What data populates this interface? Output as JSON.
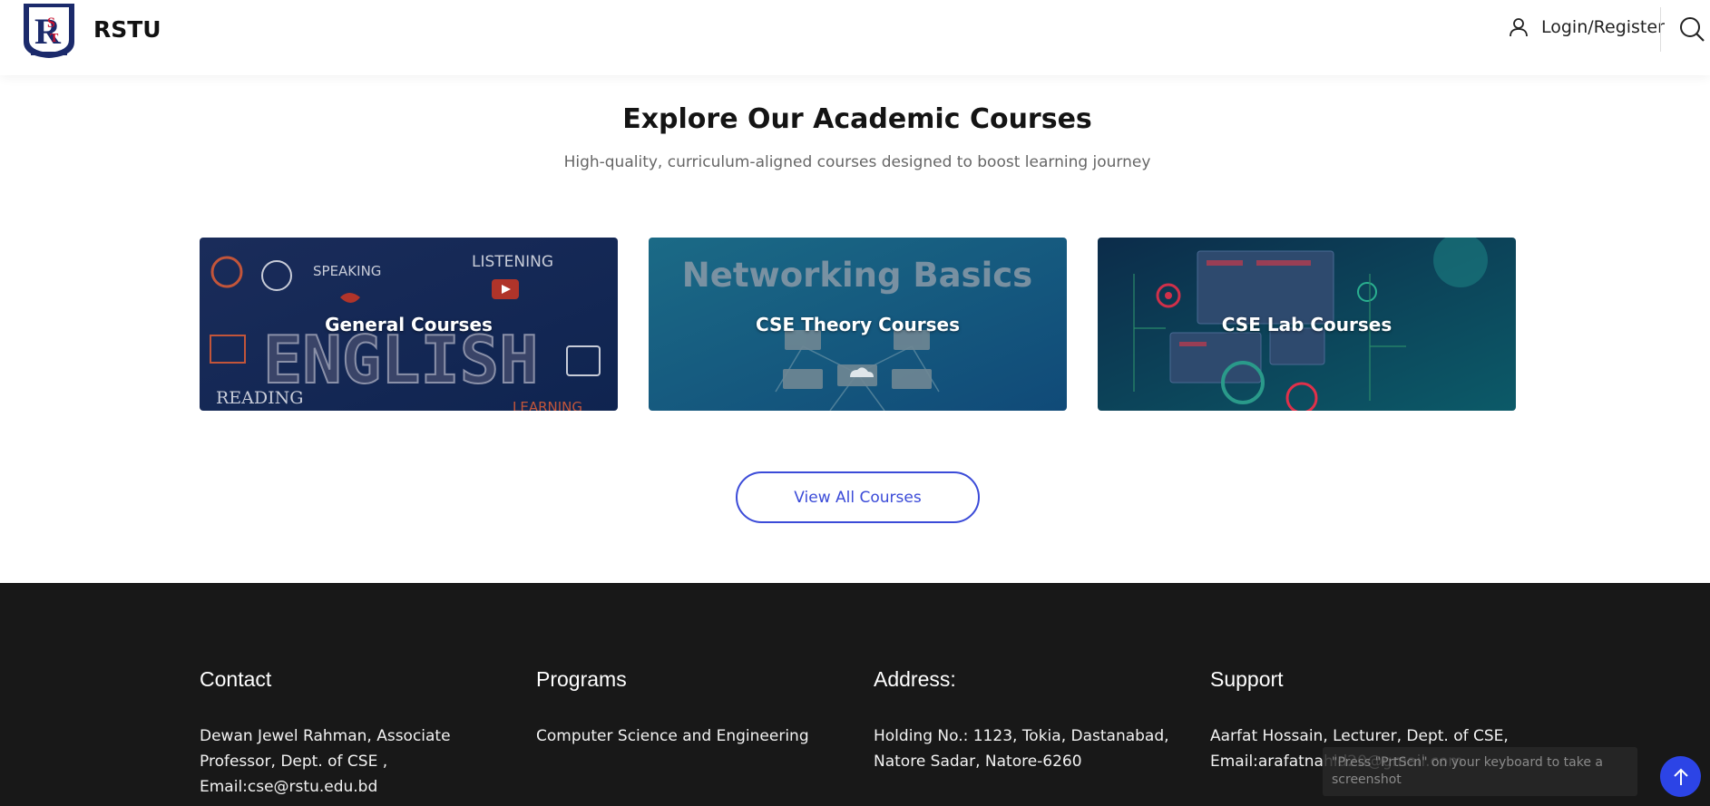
{
  "header": {
    "brand": "RSTU",
    "login_label": "Login/Register"
  },
  "section": {
    "title": "Explore Our Academic Courses",
    "subtitle": "High-quality, curriculum-aligned courses designed to boost learning journey"
  },
  "cards": [
    {
      "label": "General Courses"
    },
    {
      "label": "CSE Theory Courses",
      "image_text": "Networking Basics"
    },
    {
      "label": "CSE Lab Courses"
    }
  ],
  "card1_words": {
    "speaking": "SPEAKING",
    "listening": "LISTENING",
    "english": "ENGLISH",
    "reading": "READING",
    "learning": "LEARNING"
  },
  "view_all_label": "View All Courses",
  "footer": {
    "contact": {
      "title": "Contact",
      "text": "Dewan Jewel Rahman, Associate Professor, Dept. of CSE , Email:cse@rstu.edu.bd"
    },
    "programs": {
      "title": "Programs",
      "text": "Computer Science and Engineering"
    },
    "address": {
      "title": "Address:",
      "text": "Holding No.: 1123, Tokia, Dastanabad, Natore Sadar, Natore-6260"
    },
    "support": {
      "title": "Support",
      "text": "Aarfat Hossain, Lecturer, Dept. of CSE, Email:arafatnahid20@gmail.com"
    }
  },
  "toast_text": "\"Press \"PrtScn\" on your keyboard to take a screenshot",
  "colors": {
    "accent": "#3b4bd8",
    "footer_bg": "#181818",
    "scroll_button": "#2c44e6"
  },
  "icons": {
    "user": "user-icon",
    "search": "search-icon",
    "scroll_top": "arrow-up-icon"
  }
}
